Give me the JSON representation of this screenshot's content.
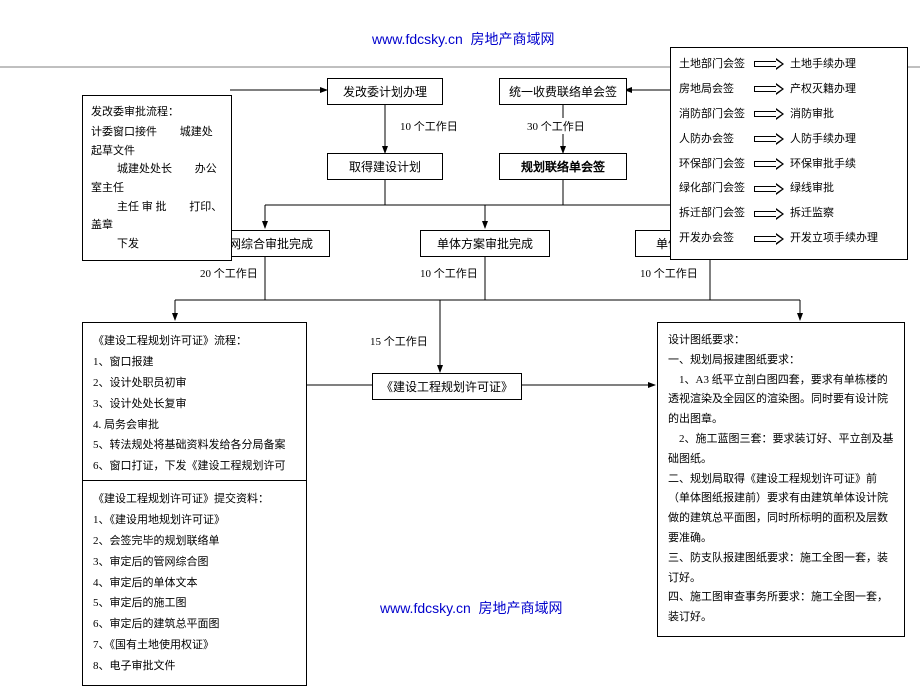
{
  "header": {
    "url": "www.fdcsky.cn",
    "site": "房地产商域网"
  },
  "nodes": {
    "n1": "发改委计划办理",
    "n2": "统一收费联络单会签",
    "n3": "取得建设计划",
    "n4": "规划联络单会签",
    "n5": "管网综合审批完成",
    "n6": "单体方案审批完成",
    "n7": "单体施工图审批完成",
    "n8": "《建设工程规划许可证》"
  },
  "edges": {
    "e1": "10 个工作日",
    "e2": "30 个工作日",
    "e5": "20 个工作日",
    "e6": "10 个工作日",
    "e7": "10 个工作日",
    "e8": "15 个工作日"
  },
  "leftPanel": {
    "title": "发改委审批流程：",
    "flow": [
      "计委窗口接件",
      "城建处起草文件",
      "城建处处长",
      "办公室主任",
      "主任 审 批",
      "打印、盖章",
      "下发"
    ]
  },
  "rightPanel": {
    "rows": [
      [
        "土地部门会签",
        "土地手续办理"
      ],
      [
        "房地局会签",
        "产权灭籍办理"
      ],
      [
        "消防部门会签",
        "消防审批"
      ],
      [
        "人防办会签",
        "人防手续办理"
      ],
      [
        "环保部门会签",
        "环保审批手续"
      ],
      [
        "绿化部门会签",
        "绿线审批"
      ],
      [
        "拆迁部门会签",
        "拆迁监察"
      ],
      [
        "开发办会签",
        "开发立项手续办理"
      ]
    ]
  },
  "procPanel": {
    "title": "《建设工程规划许可证》流程：",
    "items": [
      "1、窗口报建",
      "2、设计处职员初审",
      "3、设计处处长复审",
      "4. 局务会审批",
      "5、转法规处将基础资料发给各分局备案",
      "6、窗口打证，下发《建设工程规划许可"
    ]
  },
  "docsPanel": {
    "title": "《建设工程规划许可证》提交资料：",
    "items": [
      "1、《建设用地规划许可证》",
      "2、会签完毕的规划联络单",
      "3、审定后的管网综合图",
      "4、审定后的单体文本",
      "5、审定后的施工图",
      "6、审定后的建筑总平面图",
      "7、《国有土地使用权证》",
      "8、电子审批文件"
    ]
  },
  "reqPanel": {
    "l1": "设计图纸要求：",
    "l2": "一、规划局报建图纸要求：",
    "l3": "　1、A3 纸平立剖白图四套，要求有单栋楼的透视渲染及全园区的渲染图。同时要有设计院的出图章。",
    "l4": "　2、施工蓝图三套：要求装订好、平立剖及基础图纸。",
    "l5": "二、规划局取得《建设工程规划许可证》前（单体图纸报建前）要求有由建筑单体设计院做的建筑总平面图，同时所标明的面积及层数要准确。",
    "l6": "三、防支队报建图纸要求：施工全图一套，装订好。",
    "l7": "四、施工图审查事务所要求：施工全图一套，装订好。"
  }
}
